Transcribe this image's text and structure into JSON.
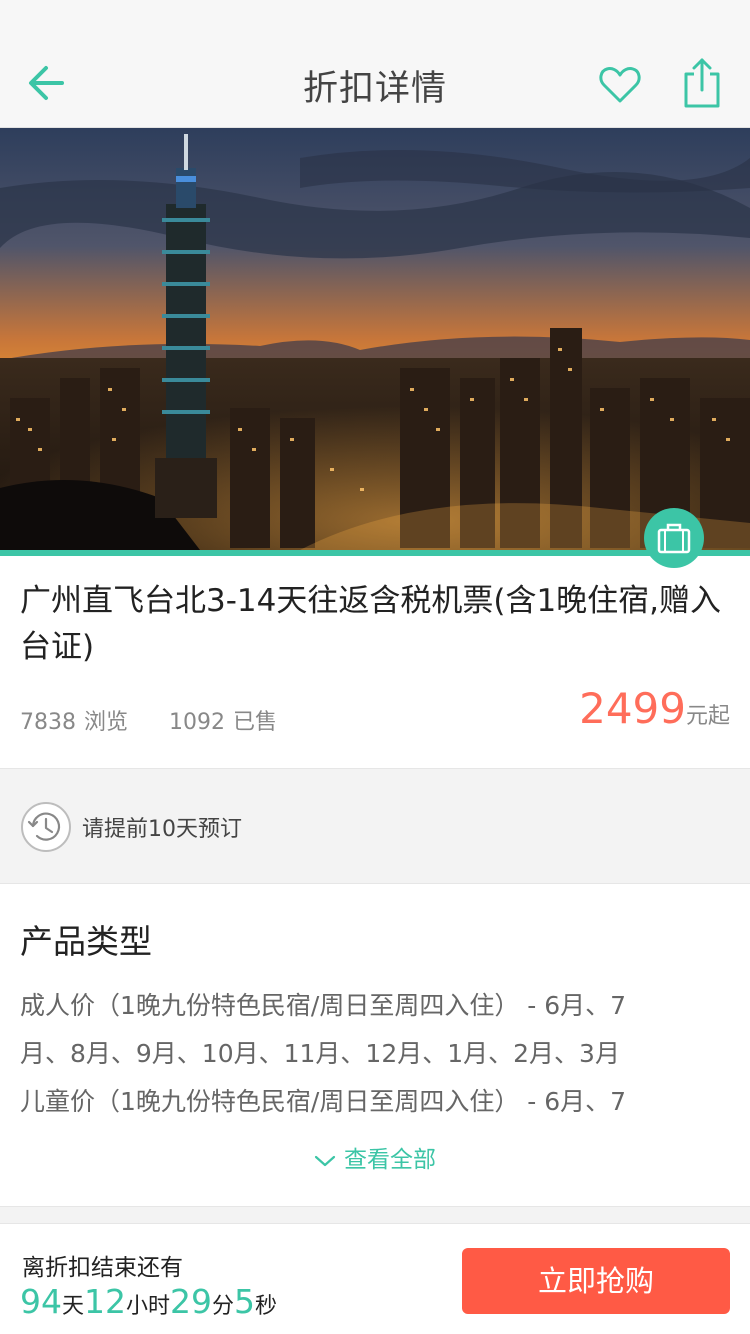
{
  "header": {
    "title": "折扣详情"
  },
  "product": {
    "title": "广州直飞台北3-14天往返含税机票(含1晚住宿,赠入台证)",
    "views_count": "7838",
    "views_label": "浏览",
    "sold_count": "1092",
    "sold_label": "已售",
    "price": "2499",
    "price_unit": "元起"
  },
  "notice": {
    "text": "请提前10天预订"
  },
  "product_types": {
    "section_title": "产品类型",
    "lines": [
      "成人价（1晚九份特色民宿/周日至周四入住） - 6月、7",
      "月、8月、9月、10月、11月、12月、1月、2月、3月",
      "儿童价（1晚九份特色民宿/周日至周四入住） - 6月、7"
    ],
    "view_all_label": "查看全部"
  },
  "countdown": {
    "label": "离折扣结束还有",
    "days": "94",
    "days_unit": "天",
    "hours": "12",
    "hours_unit": "小时",
    "minutes": "29",
    "minutes_unit": "分",
    "seconds": "5",
    "seconds_unit": "秒"
  },
  "actions": {
    "buy_label": "立即抢购"
  },
  "icons": {
    "back": "arrow-left-icon",
    "favorite": "heart-icon",
    "share": "share-icon",
    "category": "suitcase-icon",
    "notice": "clock-icon",
    "expand": "chevron-down-icon"
  },
  "colors": {
    "accent": "#3cc5a6",
    "price": "#ff6d5a",
    "buy_button": "#ff5a45"
  }
}
